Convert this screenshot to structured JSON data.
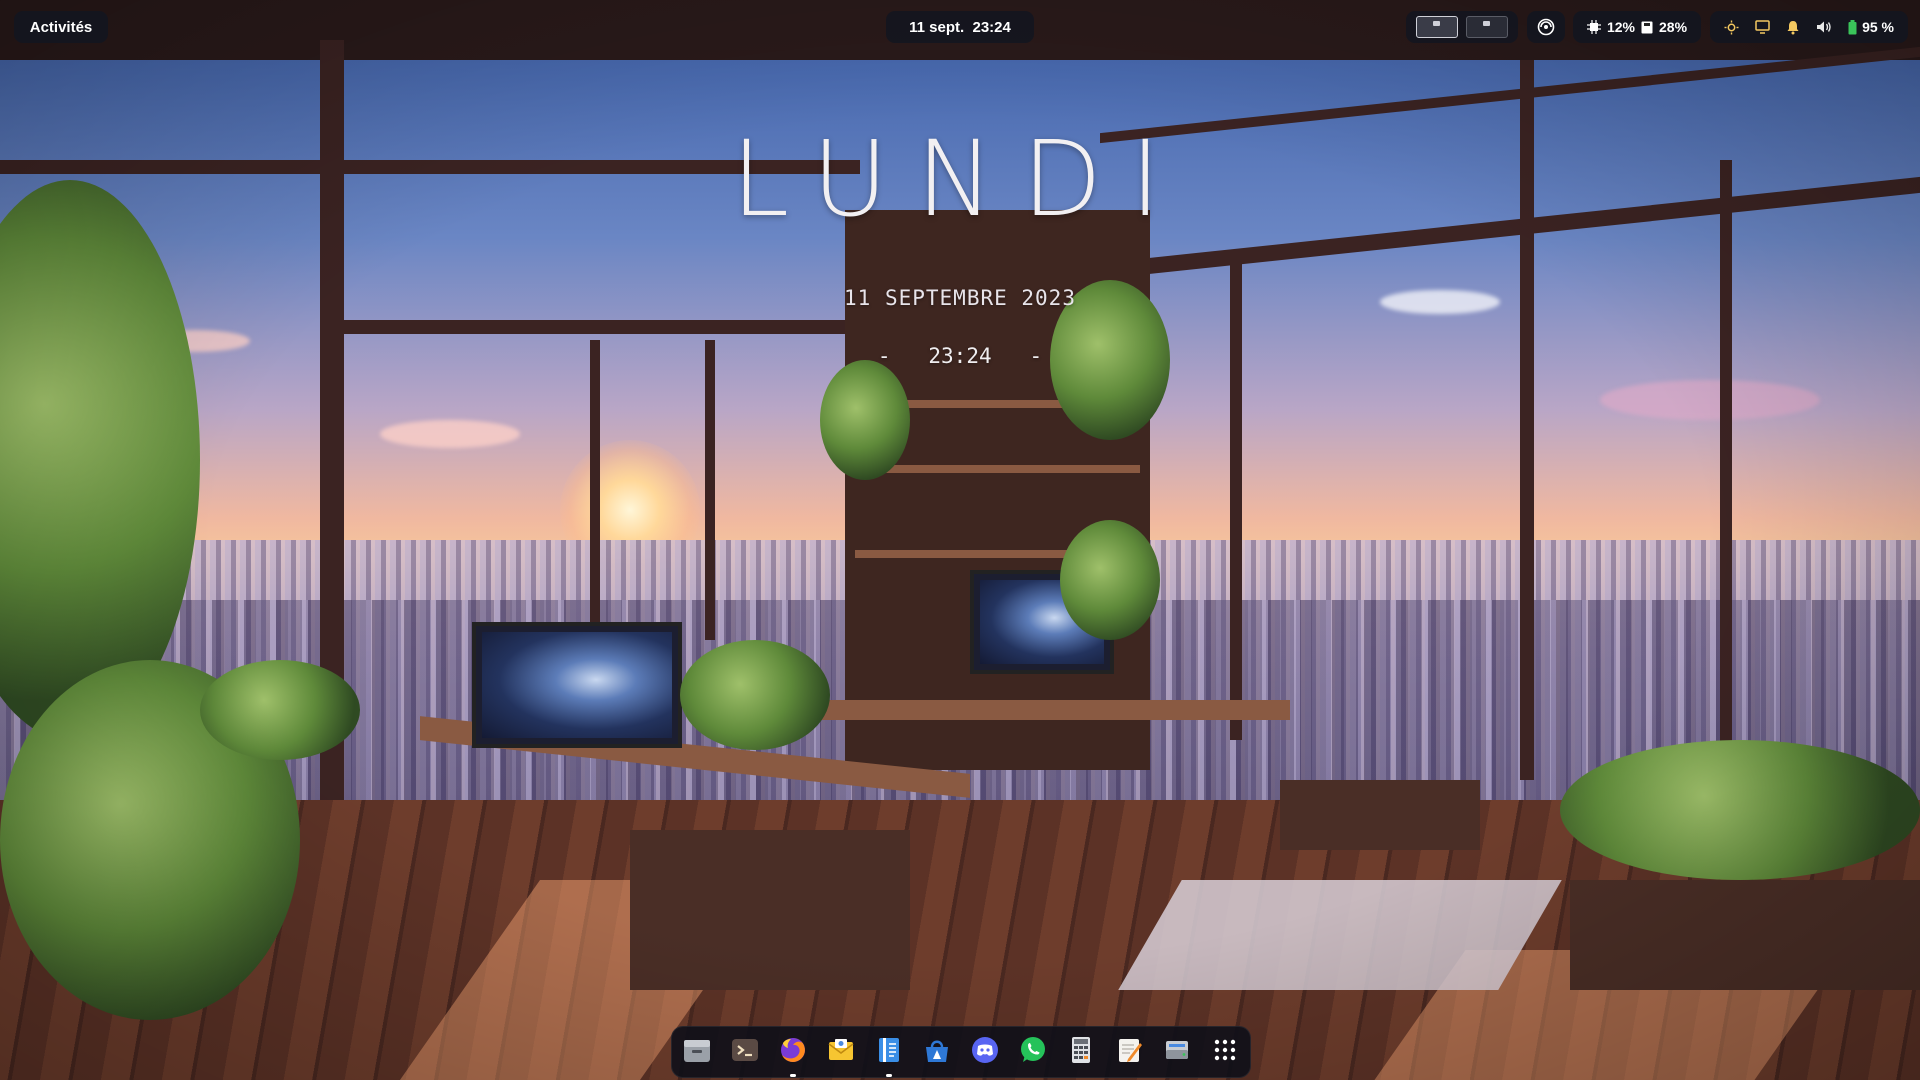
{
  "topbar": {
    "activities_label": "Activités",
    "clock_label": "11 sept.  23:24",
    "workspaces": [
      {
        "name": "workspace-1",
        "active": true
      },
      {
        "name": "workspace-2",
        "active": false
      }
    ],
    "cpu_label": "12%",
    "memory_label": "28%",
    "battery_label": "95 %"
  },
  "desktop_widget": {
    "day_label": "LUNDI",
    "date_label": "11 SEPTEMBRE 2023",
    "time_label": "-   23:24   -"
  },
  "dock": {
    "apps": [
      {
        "icon": "files-icon",
        "running": false
      },
      {
        "icon": "terminal-icon",
        "running": false
      },
      {
        "icon": "firefox-icon",
        "running": true
      },
      {
        "icon": "mail-icon",
        "running": false
      },
      {
        "icon": "text-editor-icon",
        "running": true
      },
      {
        "icon": "app-store-icon",
        "running": false
      },
      {
        "icon": "discord-icon",
        "running": false
      },
      {
        "icon": "whatsapp-icon",
        "running": false
      },
      {
        "icon": "calculator-icon",
        "running": false
      },
      {
        "icon": "notes-icon",
        "running": false
      },
      {
        "icon": "disk-utility-icon",
        "running": false
      },
      {
        "icon": "app-grid-icon",
        "running": false
      }
    ]
  },
  "colors": {
    "panel_bg": "#14161f",
    "accent_green": "#3ac45a"
  }
}
